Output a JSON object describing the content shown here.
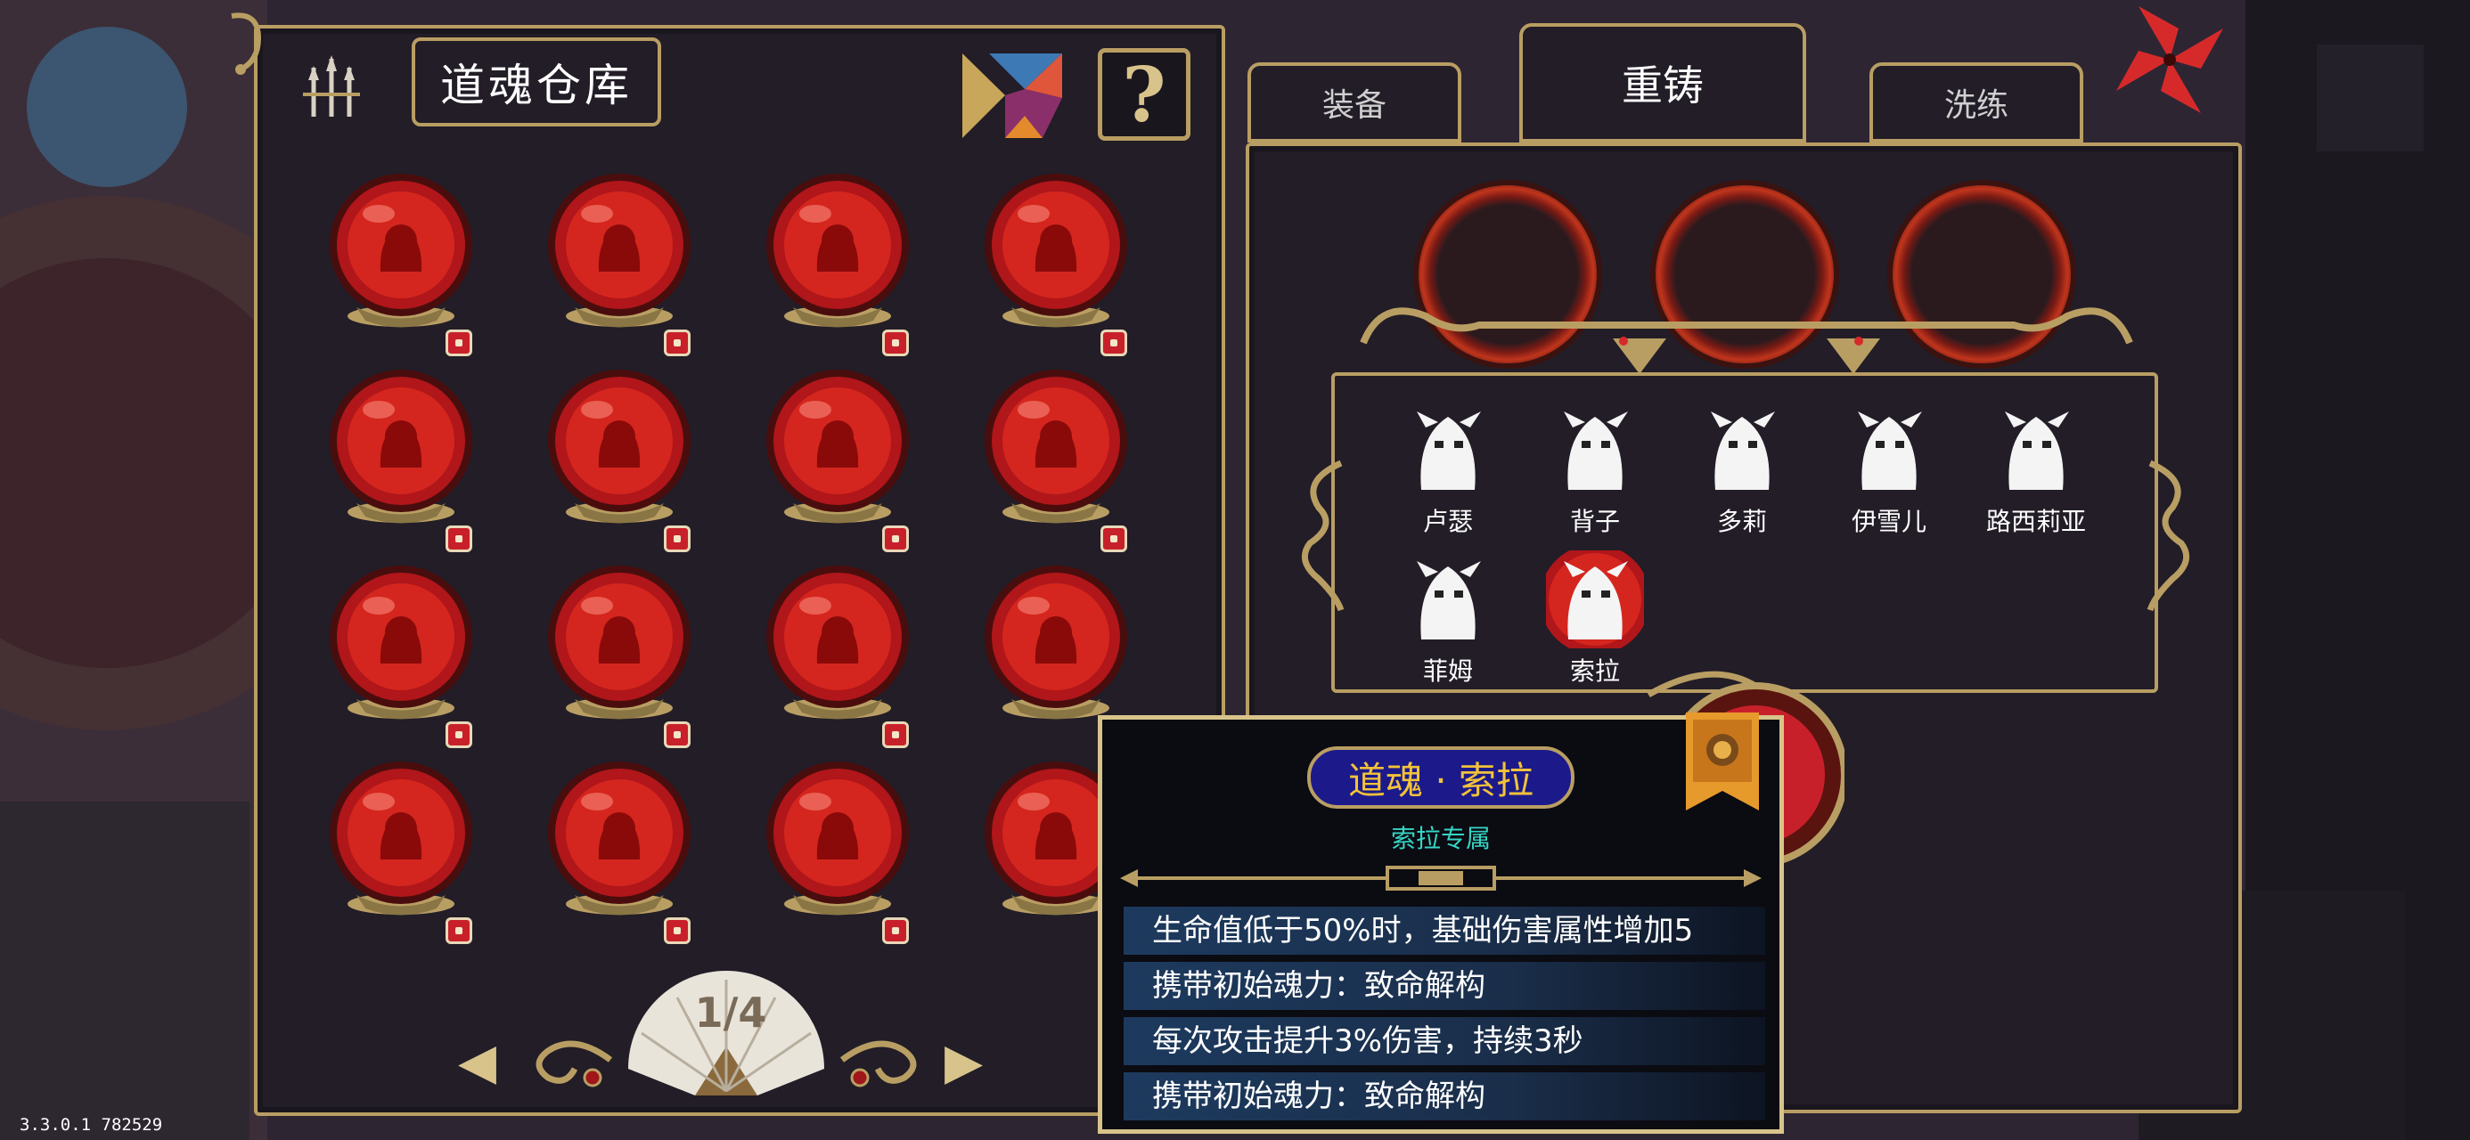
{
  "storage": {
    "title": "道魂仓库",
    "help_label": "?",
    "page_indicator": "1/4",
    "prev_label": "◀",
    "next_label": "▶",
    "orbs": [
      {
        "icon": "soul-orb-icon",
        "row": 0,
        "col": 0
      },
      {
        "icon": "soul-orb-icon",
        "row": 0,
        "col": 1
      },
      {
        "icon": "soul-orb-icon",
        "row": 0,
        "col": 2
      },
      {
        "icon": "soul-orb-icon",
        "row": 0,
        "col": 3
      },
      {
        "icon": "soul-orb-icon",
        "row": 1,
        "col": 0
      },
      {
        "icon": "soul-orb-icon",
        "row": 1,
        "col": 1
      },
      {
        "icon": "soul-orb-icon",
        "row": 1,
        "col": 2
      },
      {
        "icon": "soul-orb-icon",
        "row": 1,
        "col": 3
      },
      {
        "icon": "soul-orb-icon",
        "row": 2,
        "col": 0
      },
      {
        "icon": "soul-orb-icon",
        "row": 2,
        "col": 1
      },
      {
        "icon": "soul-orb-icon",
        "row": 2,
        "col": 2
      },
      {
        "icon": "soul-orb-icon",
        "row": 2,
        "col": 3
      },
      {
        "icon": "soul-orb-icon",
        "row": 3,
        "col": 0
      },
      {
        "icon": "soul-orb-icon",
        "row": 3,
        "col": 1
      },
      {
        "icon": "soul-orb-icon",
        "row": 3,
        "col": 2
      },
      {
        "icon": "soul-orb-icon",
        "row": 3,
        "col": 3
      }
    ]
  },
  "tabs": [
    {
      "label": "装备",
      "active": false
    },
    {
      "label": "重铸",
      "active": true
    },
    {
      "label": "洗练",
      "active": false
    }
  ],
  "characters": [
    {
      "name": "卢瑟",
      "selected": false
    },
    {
      "name": "背子",
      "selected": false
    },
    {
      "name": "多莉",
      "selected": false
    },
    {
      "name": "伊雪儿",
      "selected": false
    },
    {
      "name": "路西莉亚",
      "selected": false
    },
    {
      "name": "菲姆",
      "selected": false
    },
    {
      "name": "索拉",
      "selected": true
    }
  ],
  "tooltip": {
    "title": "道魂 · 索拉",
    "subtitle": "索拉专属",
    "lines": [
      "生命值低于50%时，基础伤害属性增加5",
      "携带初始魂力：致命解构",
      "每次攻击提升3%伤害，持续3秒",
      "携带初始魂力：致命解构"
    ]
  },
  "recast_label": "重铸",
  "version": "3.3.0.1 782529",
  "colors": {
    "gold_border": "#b99e63",
    "panel_bg": "#221d27",
    "orb_red": "#c8202a",
    "tooltip_title_bg": "#1c1a8a",
    "tooltip_title_text": "#f2c23a",
    "subtitle_cyan": "#35d6c4"
  }
}
